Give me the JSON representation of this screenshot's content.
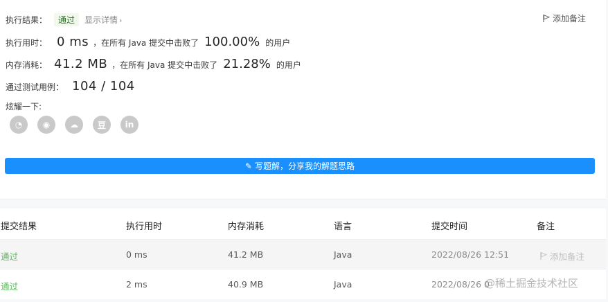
{
  "result": {
    "label": "执行结果：",
    "status": "通过",
    "detail_link": "显示详情",
    "add_note": "添加备注"
  },
  "runtime": {
    "label": "执行用时：",
    "value": "0 ms",
    "prefix": "，在所有 Java 提交中击败了",
    "percent": "100.00%",
    "suffix": "的用户"
  },
  "memory": {
    "label": "内存消耗：",
    "value": "41.2 MB",
    "prefix": "，在所有 Java 提交中击败了",
    "percent": "21.28%",
    "suffix": "的用户"
  },
  "tests": {
    "label": "通过测试用例：",
    "value": "104 / 104"
  },
  "share": {
    "label": "炫耀一下:",
    "icons": [
      "wechat-icon",
      "weibo-icon",
      "qq-icon",
      "douban-icon",
      "linkedin-icon"
    ],
    "glyphs": [
      "◔",
      "◉",
      "☁",
      "豆",
      "in"
    ]
  },
  "write_solution": "写题解，分享我的解题思路",
  "table": {
    "headers": [
      "提交结果",
      "执行用时",
      "内存消耗",
      "语言",
      "提交时间",
      "备注"
    ],
    "rows": [
      {
        "status": "通过",
        "runtime": "0 ms",
        "memory": "41.2 MB",
        "language": "Java",
        "time": "2022/08/26 12:51",
        "note": "添加备注"
      },
      {
        "status": "通过",
        "runtime": "2 ms",
        "memory": "40.9 MB",
        "language": "Java",
        "time": "2022/08/26 0",
        "note": ""
      }
    ]
  },
  "watermark": "@稀土掘金技术社区",
  "colors": {
    "accent": "#1a90ff",
    "success": "#5cb85c",
    "badge_bg": "#f0f9eb"
  }
}
